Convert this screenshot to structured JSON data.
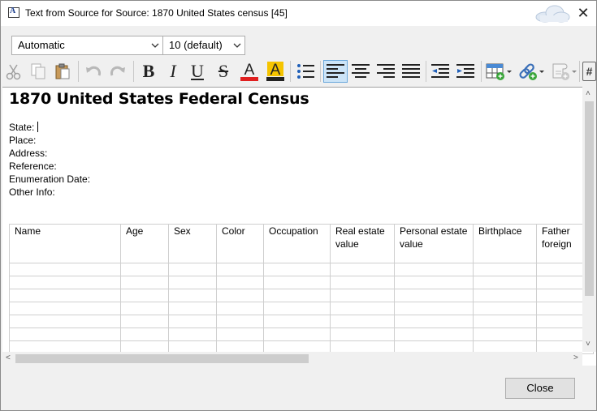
{
  "window": {
    "title": "Text from Source for Source: 1870 United States census [45]",
    "close_symbol": "✕"
  },
  "format_bar": {
    "font_value": "Automatic",
    "size_value": "10 (default)"
  },
  "toolbar": {
    "icons": [
      "cut-icon",
      "copy-icon",
      "paste-icon",
      "undo-icon",
      "redo-icon",
      "bold-icon",
      "italic-icon",
      "underline-icon",
      "strikethrough-icon",
      "font-color-icon",
      "highlight-color-icon",
      "bullet-list-icon",
      "align-left-icon",
      "align-center-icon",
      "align-right-icon",
      "justify-icon",
      "decrease-indent-icon",
      "increase-indent-icon",
      "insert-table-icon",
      "insert-link-icon",
      "insert-source-icon",
      "field-icon"
    ],
    "bold": "B",
    "italic": "I",
    "underline": "U",
    "strike": "S",
    "font_color": "A",
    "highlight": "A",
    "field": "#",
    "font_color_hex": "#e02020",
    "highlight_hex": "#f5c400",
    "active_hex": "#cce4f7"
  },
  "document": {
    "heading": "1870 United States Federal Census",
    "fields": [
      "State:",
      "Place:",
      "Address:",
      "Reference:",
      "Enumeration Date:",
      "Other Info:"
    ],
    "table": {
      "headers": [
        "Name",
        "Age",
        "Sex",
        "Color",
        "Occupation",
        "Real estate value",
        "Personal estate value",
        "Birthplace",
        "Father foreign"
      ]
    }
  },
  "footer": {
    "close_label": "Close"
  }
}
